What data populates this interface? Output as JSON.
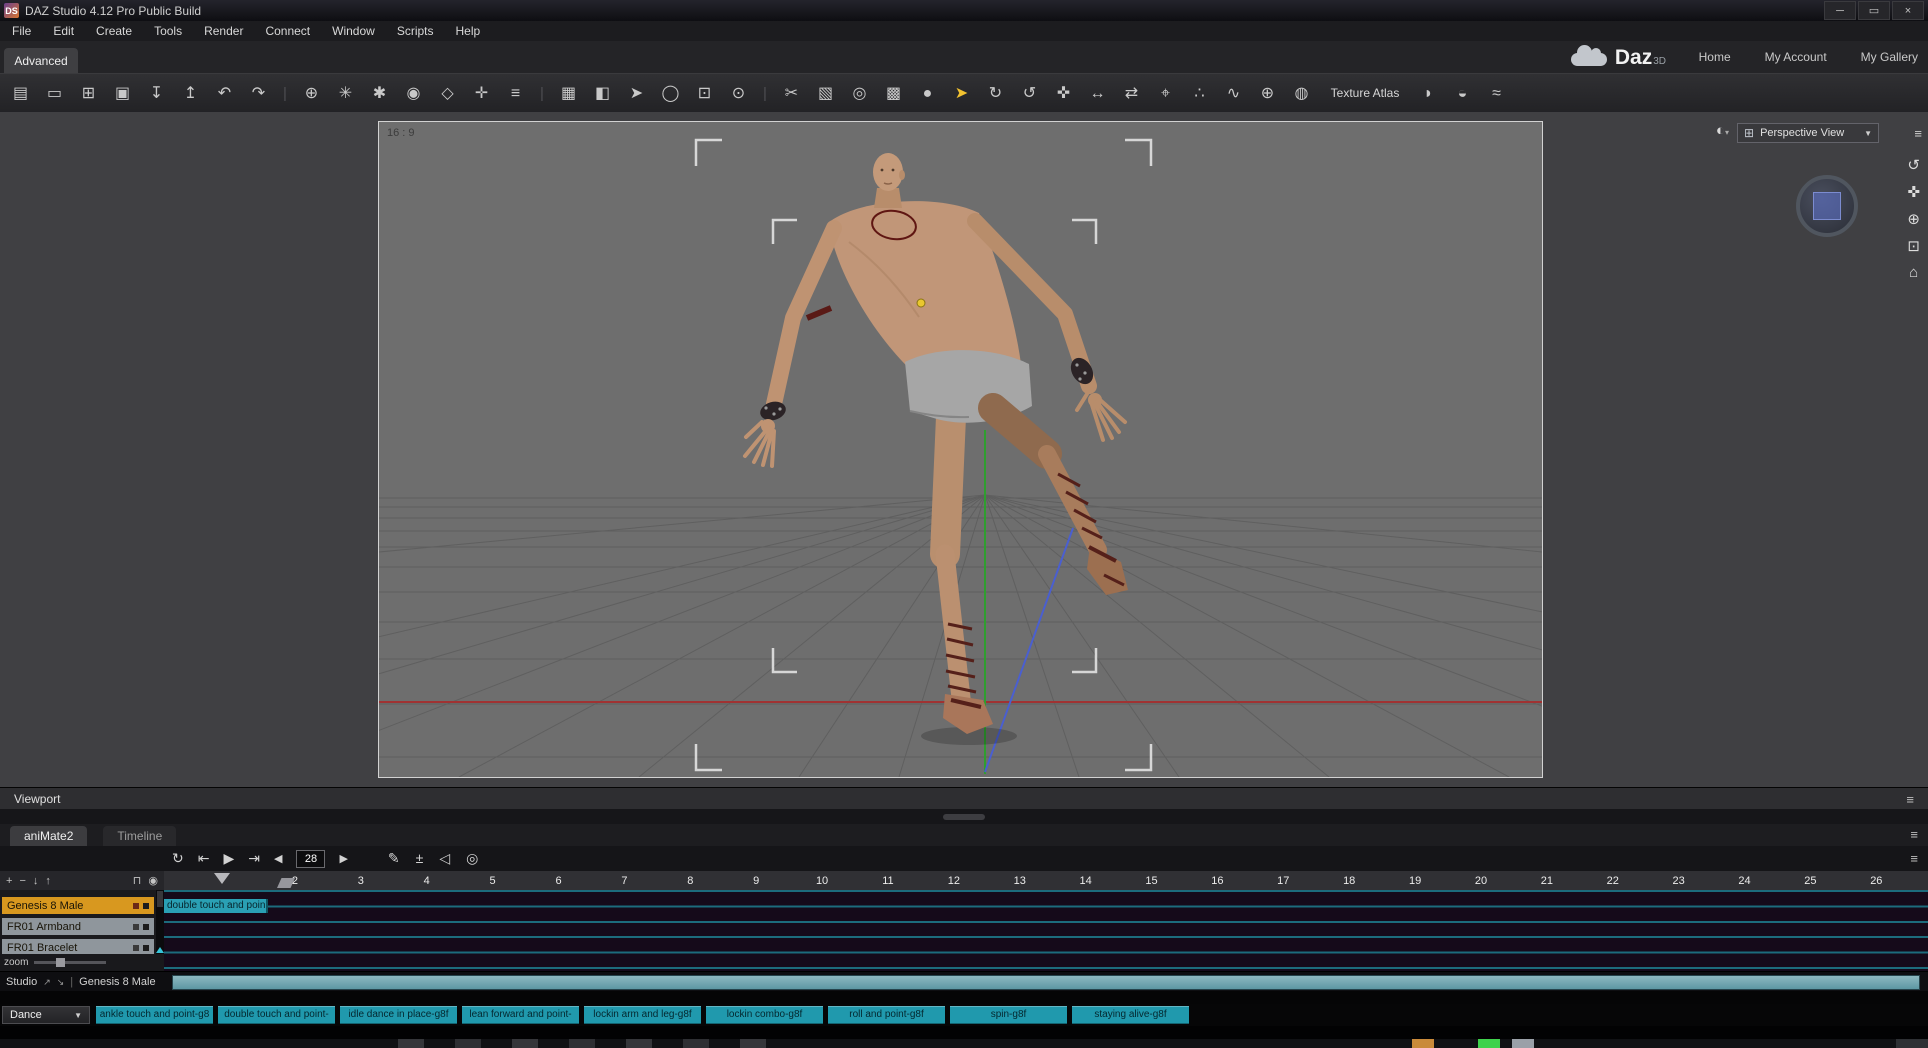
{
  "colors": {
    "accent_teal": "#2aa0b4",
    "track_highlight": "#d8981f",
    "viewport_bg": "#6e6e6e",
    "scrub_teal": "#5d97a3"
  },
  "window": {
    "logo": "DS",
    "title": "DAZ Studio 4.12 Pro Public Build",
    "controls": {
      "minimize": "─",
      "restore": "▭",
      "close": "×"
    }
  },
  "menu": {
    "items": [
      "File",
      "Edit",
      "Create",
      "Tools",
      "Render",
      "Connect",
      "Window",
      "Scripts",
      "Help"
    ]
  },
  "header": {
    "active_tab": "Advanced",
    "brand": "Daz",
    "brand_sup": "3D",
    "links": [
      "Home",
      "My Account",
      "My Gallery"
    ]
  },
  "toolbar": {
    "items": [
      {
        "name": "new-file-icon",
        "glyph": "▤"
      },
      {
        "name": "open-file-icon",
        "glyph": "▭"
      },
      {
        "name": "merge-file-icon",
        "glyph": "⊞"
      },
      {
        "name": "save-file-icon",
        "glyph": "▣"
      },
      {
        "name": "import-file-icon",
        "glyph": "↧"
      },
      {
        "name": "export-file-icon",
        "glyph": "↥"
      },
      {
        "name": "undo-icon",
        "glyph": "↶"
      },
      {
        "name": "redo-icon",
        "glyph": "↷"
      },
      {
        "name": "toolbar-separator",
        "glyph": "|",
        "inter": false
      },
      {
        "name": "create-figure-icon",
        "glyph": "⊕"
      },
      {
        "name": "create-prop-icon",
        "glyph": "✳"
      },
      {
        "name": "create-light-icon",
        "glyph": "✱"
      },
      {
        "name": "create-camera-icon",
        "glyph": "◉"
      },
      {
        "name": "create-null-icon",
        "glyph": "◇"
      },
      {
        "name": "create-instance-icon",
        "glyph": "✛"
      },
      {
        "name": "align-pane-icon",
        "glyph": "≡"
      },
      {
        "name": "toolbar-separator",
        "glyph": "|",
        "inter": false
      },
      {
        "name": "layout-grid-icon",
        "glyph": "▦"
      },
      {
        "name": "camera-cube-icon",
        "glyph": "◧"
      },
      {
        "name": "select-arrow-icon",
        "glyph": "➤"
      },
      {
        "name": "sphere-tool-icon",
        "glyph": "◯"
      },
      {
        "name": "cube-camera-icon",
        "glyph": "⊡"
      },
      {
        "name": "render-icon",
        "glyph": "⊙"
      },
      {
        "name": "toolbar-separator",
        "glyph": "|",
        "inter": false
      },
      {
        "name": "scissors-icon",
        "glyph": "✂"
      },
      {
        "name": "image-editor-icon",
        "glyph": "▧"
      },
      {
        "name": "render-preview-icon",
        "glyph": "◎"
      },
      {
        "name": "shader-layers-icon",
        "glyph": "▩"
      },
      {
        "name": "shaded-sphere-icon",
        "glyph": "●"
      },
      {
        "name": "active-pointer-icon",
        "glyph": "➤"
      },
      {
        "name": "rotate-tool-icon",
        "glyph": "↻"
      },
      {
        "name": "orbit-tool-icon",
        "glyph": "↺"
      },
      {
        "name": "universal-tool-icon",
        "glyph": "✜"
      },
      {
        "name": "scale-tool-icon",
        "glyph": "↔"
      },
      {
        "name": "translate-tool-icon",
        "glyph": "⇄"
      },
      {
        "name": "aim-tool-icon",
        "glyph": "⌖"
      },
      {
        "name": "snap-tool-icon",
        "glyph": "∴"
      },
      {
        "name": "measure-tool-icon",
        "glyph": "∿"
      },
      {
        "name": "add-node-icon",
        "glyph": "⊕"
      },
      {
        "name": "texture-atlas-globe-icon",
        "glyph": "◍"
      },
      {
        "name": "texture-atlas-label",
        "glyph": "Texture Atlas",
        "inter": false
      },
      {
        "name": "decimator-icon",
        "glyph": "◗"
      },
      {
        "name": "people-icon",
        "glyph": "◒"
      },
      {
        "name": "hair-icon",
        "glyph": "≈"
      }
    ]
  },
  "viewport": {
    "aspect_label": "16 : 9",
    "camera_view": "Perspective View",
    "dropdown_arrow": "▼",
    "pane_label": "Viewport",
    "icons": {
      "pane_menu": "≡",
      "draw_style": "◐",
      "grid": "⊞",
      "orbit": "↺",
      "pan": "✜",
      "zoom": "⊕",
      "frame": "⊡",
      "home": "⌂"
    }
  },
  "timeline": {
    "tabs": {
      "animate": "aniMate2",
      "timeline": "Timeline"
    },
    "transport": {
      "loop": "↻",
      "to_start": "⇤",
      "play": "▶",
      "to_end": "⇥",
      "prev": "◀",
      "frame": "28",
      "next": "▶",
      "edit": "✎",
      "keys": "±",
      "audio": "◁",
      "record": "◎",
      "pane_menu": "≡"
    },
    "panel_icons": {
      "add": "+",
      "remove": "−",
      "down": "↓",
      "up": "↑",
      "lock": "⊓",
      "visibility": "◉"
    },
    "ruler": [
      2,
      3,
      4,
      5,
      6,
      7,
      8,
      9,
      10,
      11,
      12,
      13,
      14,
      15,
      16,
      17,
      18,
      19,
      20,
      21,
      22,
      23,
      24,
      25,
      26
    ],
    "tracks": [
      {
        "label": "Genesis 8 Male"
      },
      {
        "label": "FR01 Armband"
      },
      {
        "label": "FR01 Bracelet"
      }
    ],
    "clip_label": "double touch and poin",
    "zoom_label": "zoom"
  },
  "status": {
    "app": "Studio",
    "icon_a": "↗",
    "icon_b": "↘",
    "separator": "|",
    "selection": "Genesis 8 Male"
  },
  "clipbar": {
    "category": "Dance",
    "arrow": "▼",
    "clips": [
      "ankle touch and point-g8",
      "double touch and point-",
      "idle dance in place-g8f",
      "lean forward and point-",
      "lockin arm and leg-g8f",
      "lockin combo-g8f",
      "roll and point-g8f",
      "spin-g8f",
      "staying alive-g8f"
    ]
  }
}
